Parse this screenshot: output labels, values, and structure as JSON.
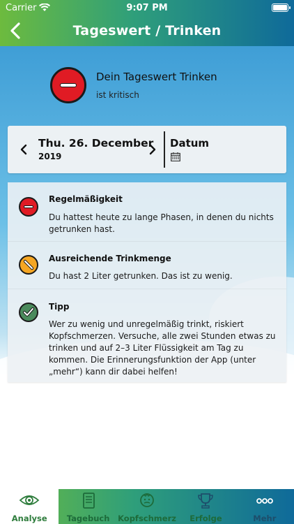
{
  "status_bar": {
    "carrier": "Carrier",
    "time": "9:07 PM"
  },
  "nav": {
    "title": "Tageswert / Trinken",
    "back_icon": "chevron-left-icon"
  },
  "summary": {
    "title": "Dein Tageswert Trinken",
    "subtitle": "ist kritisch",
    "status_color": "#e01b24"
  },
  "date_card": {
    "date": "Thu. 26. December",
    "year": "2019",
    "picker_label": "Datum"
  },
  "info": [
    {
      "title": "Regelmäßigkeit",
      "text": "Du hattest heute zu lange Phasen, in denen du nichts getrunken hast.",
      "icon": "critical-icon",
      "color": "#e01b24"
    },
    {
      "title": "Ausreichende Trinkmenge",
      "text": "Du hast 2 Liter getrunken. Das ist zu wenig.",
      "icon": "warning-icon",
      "color": "#f5a623"
    },
    {
      "title": "Tipp",
      "text": "Wer zu wenig und unregelmäßig trinkt, riskiert Kopfschmerzen. Versuche, alle zwei Stunden etwas zu trinken und auf 2–3 Liter Flüssigkeit am Tag zu kommen. Die Erinnerungsfunktion der App (unter „mehr“) kann dir dabei helfen!",
      "icon": "check-icon",
      "color": "#4a8a5c"
    }
  ],
  "tabs": [
    {
      "label": "Analyse",
      "icon": "eye-icon",
      "active": true
    },
    {
      "label": "Tagebuch",
      "icon": "diary-icon",
      "active": false
    },
    {
      "label": "Kopfschmerz",
      "icon": "head-icon",
      "active": false
    },
    {
      "label": "Erfolge",
      "icon": "trophy-icon",
      "active": false
    },
    {
      "label": "Mehr",
      "icon": "more-icon",
      "active": false
    }
  ],
  "colors": {
    "header_start": "#6dbb3e",
    "header_end": "#0f6a9a",
    "critical": "#e01b24",
    "warning": "#f5a623",
    "ok": "#4a8a5c"
  }
}
